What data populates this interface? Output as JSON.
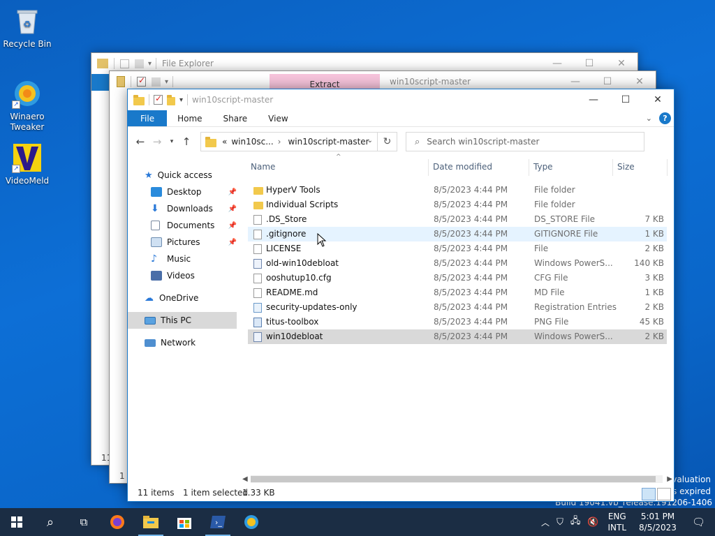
{
  "desktop": {
    "icons": [
      {
        "label": "Recycle Bin"
      },
      {
        "label": "Winaero Tweaker"
      },
      {
        "label": "VideoMeld"
      }
    ],
    "watermark": {
      "line1": "Evaluation",
      "line2": "is expired",
      "line3": "Build 19041.vb_release.191206-1406"
    }
  },
  "bg_window_1": {
    "title": "File Explorer",
    "status_items": "11"
  },
  "bg_window_2": {
    "title": "win10script-master",
    "context_tab": "Extract",
    "status_items": "1 i"
  },
  "window": {
    "title": "win10script-master",
    "ribbon": {
      "tabs": [
        "File",
        "Home",
        "Share",
        "View"
      ]
    },
    "address": {
      "prefix": "«",
      "crumb1": "win10sc...",
      "crumb2": "win10script-master"
    },
    "search": {
      "placeholder": "Search win10script-master"
    },
    "sidebar": {
      "items": [
        {
          "label": "Quick access"
        },
        {
          "label": "Desktop"
        },
        {
          "label": "Downloads"
        },
        {
          "label": "Documents"
        },
        {
          "label": "Pictures"
        },
        {
          "label": "Music"
        },
        {
          "label": "Videos"
        },
        {
          "label": "OneDrive"
        },
        {
          "label": "This PC"
        },
        {
          "label": "Network"
        }
      ]
    },
    "columns": {
      "name": "Name",
      "date": "Date modified",
      "type": "Type",
      "size": "Size"
    },
    "files": [
      {
        "name": "HyperV Tools",
        "date": "8/5/2023 4:44 PM",
        "type": "File folder",
        "size": "",
        "icon": "folder-icon"
      },
      {
        "name": "Individual Scripts",
        "date": "8/5/2023 4:44 PM",
        "type": "File folder",
        "size": "",
        "icon": "folder-icon"
      },
      {
        "name": ".DS_Store",
        "date": "8/5/2023 4:44 PM",
        "type": "DS_STORE File",
        "size": "7 KB",
        "icon": "file-icon"
      },
      {
        "name": ".gitignore",
        "date": "8/5/2023 4:44 PM",
        "type": "GITIGNORE File",
        "size": "1 KB",
        "icon": "file-icon"
      },
      {
        "name": "LICENSE",
        "date": "8/5/2023 4:44 PM",
        "type": "File",
        "size": "2 KB",
        "icon": "file-icon"
      },
      {
        "name": "old-win10debloat",
        "date": "8/5/2023 4:44 PM",
        "type": "Windows PowerS...",
        "size": "140 KB",
        "icon": "powershell-file-icon"
      },
      {
        "name": "ooshutup10.cfg",
        "date": "8/5/2023 4:44 PM",
        "type": "CFG File",
        "size": "3 KB",
        "icon": "file-icon"
      },
      {
        "name": "README.md",
        "date": "8/5/2023 4:44 PM",
        "type": "MD File",
        "size": "1 KB",
        "icon": "file-icon"
      },
      {
        "name": "security-updates-only",
        "date": "8/5/2023 4:44 PM",
        "type": "Registration Entries",
        "size": "2 KB",
        "icon": "registry-file-icon"
      },
      {
        "name": "titus-toolbox",
        "date": "8/5/2023 4:44 PM",
        "type": "PNG File",
        "size": "45 KB",
        "icon": "image-file-icon"
      },
      {
        "name": "win10debloat",
        "date": "8/5/2023 4:44 PM",
        "type": "Windows PowerS...",
        "size": "2 KB",
        "icon": "powershell-file-icon"
      }
    ],
    "status": {
      "count": "11 items",
      "selected": "1 item selected",
      "size": "1.33 KB"
    }
  },
  "taskbar": {
    "lang1": "ENG",
    "lang2": "INTL",
    "time": "5:01 PM",
    "date": "8/5/2023"
  },
  "colors": {
    "accent": "#1979ca",
    "taskbar": "#1b2d44",
    "selection": "#d9d9d9",
    "hover": "#e5f3ff",
    "extract_tab": "#f7c4dc"
  }
}
